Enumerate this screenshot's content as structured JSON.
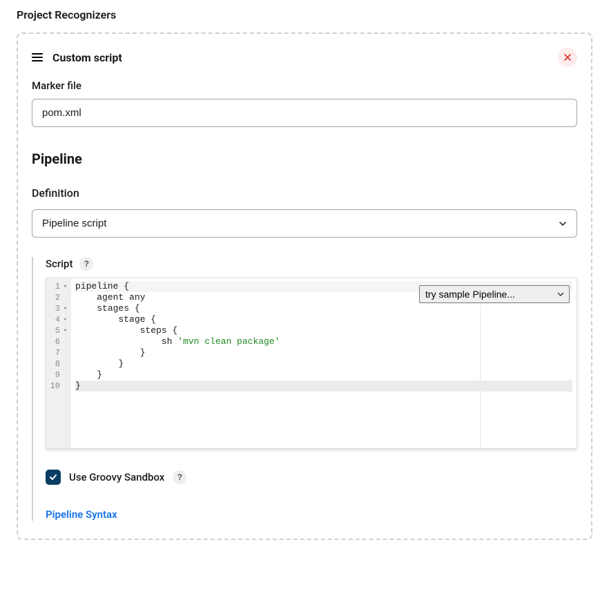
{
  "page": {
    "title": "Project Recognizers"
  },
  "config": {
    "title": "Custom script",
    "marker_file": {
      "label": "Marker file",
      "value": "pom.xml"
    },
    "pipeline_section_title": "Pipeline",
    "definition": {
      "label": "Definition",
      "selected": "Pipeline script"
    },
    "script": {
      "label": "Script",
      "help_symbol": "?",
      "sample_select": "try sample Pipeline...",
      "lines": [
        {
          "n": 1,
          "fold": true,
          "indent": "",
          "tokens": [
            {
              "t": "pipeline {",
              "c": "kw"
            }
          ],
          "cursor": true
        },
        {
          "n": 2,
          "fold": false,
          "indent": "    ",
          "tokens": [
            {
              "t": "agent any",
              "c": "kw"
            }
          ]
        },
        {
          "n": 3,
          "fold": true,
          "indent": "    ",
          "tokens": [
            {
              "t": "stages {",
              "c": "kw"
            }
          ]
        },
        {
          "n": 4,
          "fold": true,
          "indent": "        ",
          "tokens": [
            {
              "t": "stage {",
              "c": "kw"
            }
          ]
        },
        {
          "n": 5,
          "fold": true,
          "indent": "            ",
          "tokens": [
            {
              "t": "steps {",
              "c": "kw"
            }
          ]
        },
        {
          "n": 6,
          "fold": false,
          "indent": "                ",
          "tokens": [
            {
              "t": "sh ",
              "c": "kw"
            },
            {
              "t": "'mvn clean package'",
              "c": "str"
            }
          ]
        },
        {
          "n": 7,
          "fold": false,
          "indent": "            ",
          "tokens": [
            {
              "t": "}",
              "c": "kw"
            }
          ]
        },
        {
          "n": 8,
          "fold": false,
          "indent": "        ",
          "tokens": [
            {
              "t": "}",
              "c": "kw"
            }
          ]
        },
        {
          "n": 9,
          "fold": false,
          "indent": "    ",
          "tokens": [
            {
              "t": "}",
              "c": "kw"
            }
          ]
        },
        {
          "n": 10,
          "fold": false,
          "indent": "",
          "tokens": [
            {
              "t": "}",
              "c": "kw"
            }
          ],
          "highlight": true
        }
      ]
    },
    "sandbox": {
      "checked": true,
      "label": "Use Groovy Sandbox",
      "help_symbol": "?"
    },
    "syntax_link": "Pipeline Syntax"
  }
}
